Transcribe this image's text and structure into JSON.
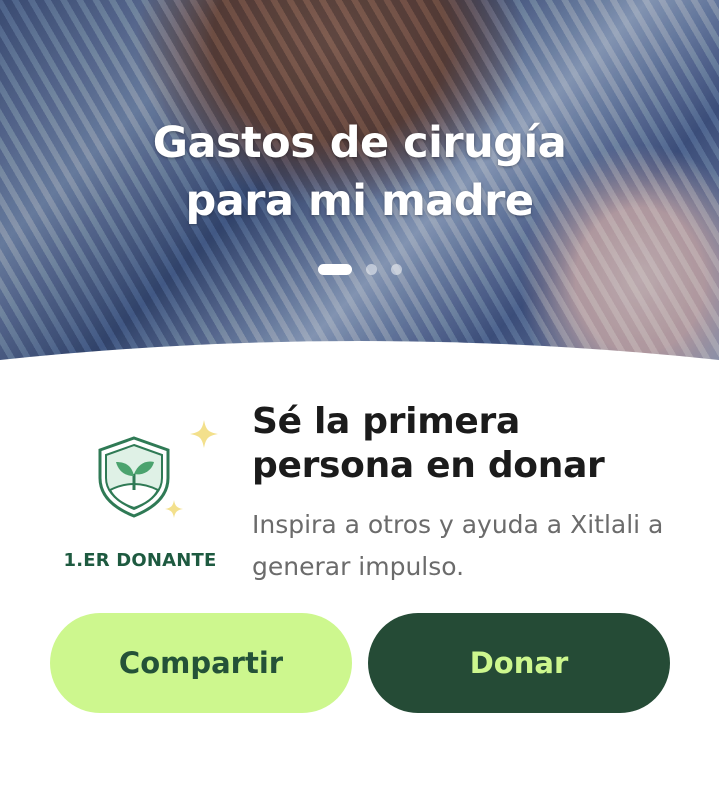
{
  "hero": {
    "title_line1": "Gastos de cirugía",
    "title_line2": "para mi madre",
    "slides_total": 3,
    "active_slide": 1
  },
  "badge": {
    "label": "1.ER DONANTE",
    "icon": "shield-sprout-icon"
  },
  "prompt": {
    "headline": "Sé la primera persona en donar",
    "subtext": "Inspira a otros y ayuda a Xitlali a generar impulso."
  },
  "actions": {
    "share_label": "Compartir",
    "donate_label": "Donar"
  },
  "colors": {
    "primary_dark": "#254b36",
    "accent_lime": "#cdf78e",
    "badge_text": "#1e5a40"
  }
}
